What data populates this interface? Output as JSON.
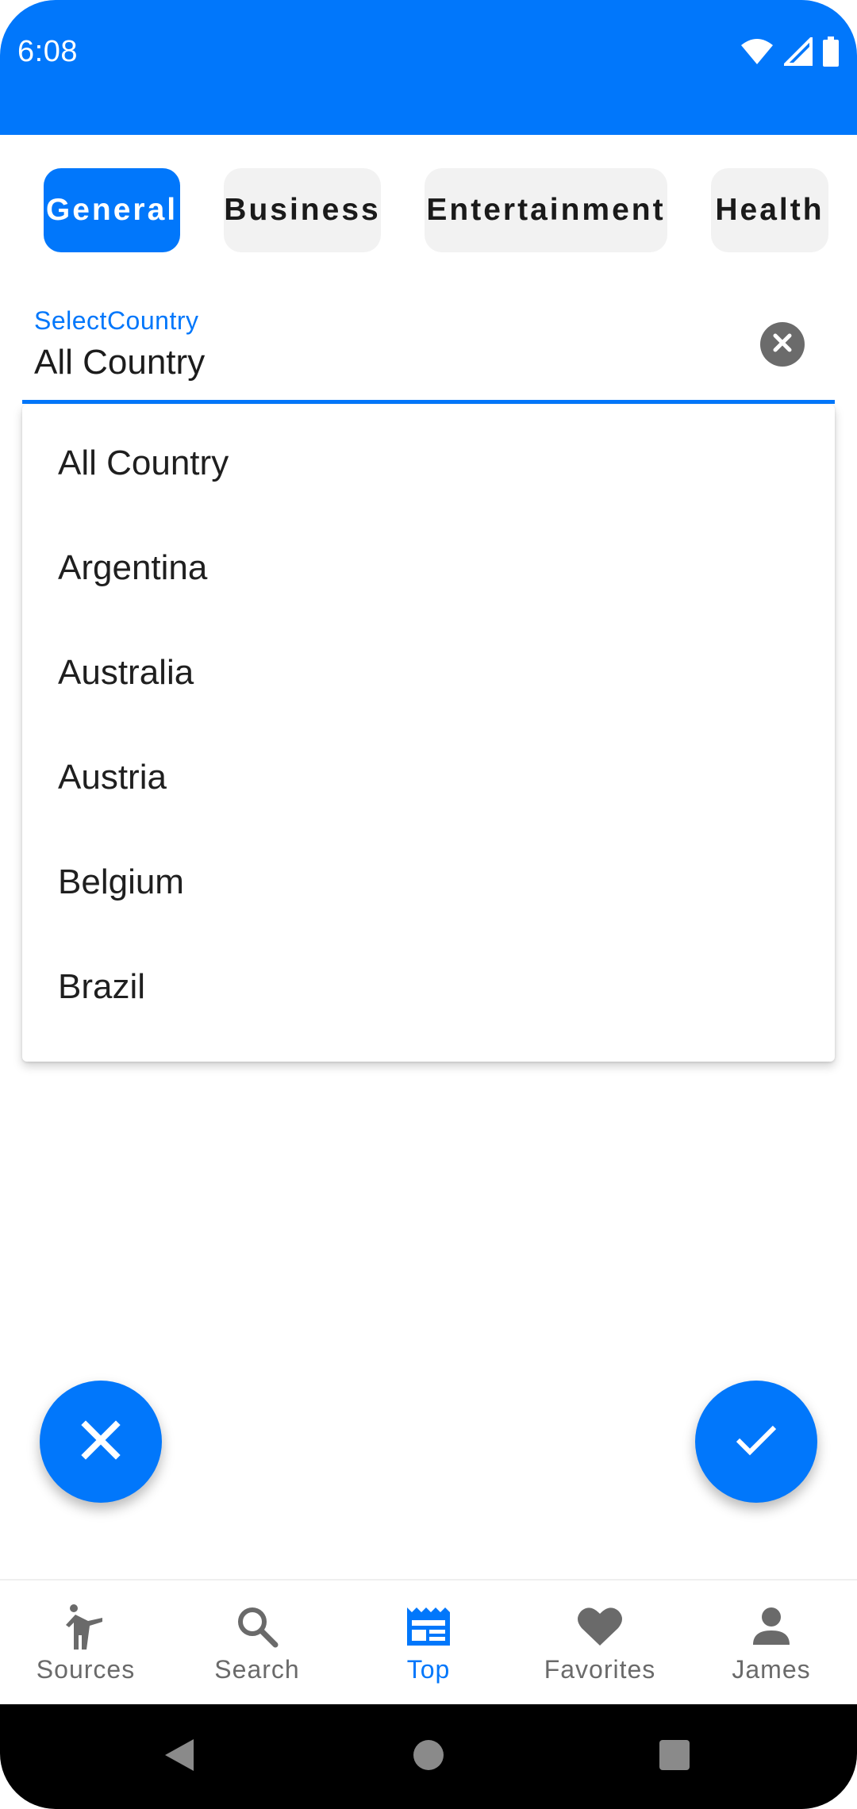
{
  "status_bar": {
    "time": "6:08",
    "icons": [
      "wifi-icon",
      "signal-icon",
      "battery-icon"
    ],
    "background": "#0177fb"
  },
  "categories": [
    {
      "label": "General",
      "active": true
    },
    {
      "label": "Business",
      "active": false
    },
    {
      "label": "Entertainment",
      "active": false
    },
    {
      "label": "Health",
      "active": false
    }
  ],
  "country_select": {
    "label": "SelectCountry",
    "value": "All Country",
    "clear_icon": "clear-circle-icon"
  },
  "dropdown": {
    "options": [
      "All Country",
      "Argentina",
      "Australia",
      "Austria",
      "Belgium",
      "Brazil"
    ]
  },
  "fabs": {
    "cancel_icon": "close-icon",
    "confirm_icon": "check-icon"
  },
  "bottom_nav": {
    "items": [
      {
        "label": "Sources",
        "icon": "person-pointing-icon",
        "active": false
      },
      {
        "label": "Search",
        "icon": "search-icon",
        "active": false
      },
      {
        "label": "Top",
        "icon": "newspaper-icon",
        "active": true
      },
      {
        "label": "Favorites",
        "icon": "heart-icon",
        "active": false
      },
      {
        "label": "James",
        "icon": "person-icon",
        "active": false
      }
    ]
  },
  "system_nav": {
    "buttons": [
      "back-icon",
      "home-icon",
      "recents-icon"
    ]
  },
  "colors": {
    "accent": "#0177fb",
    "chip_inactive": "#f2f2f2",
    "nav_inactive": "#6a6a6a"
  }
}
